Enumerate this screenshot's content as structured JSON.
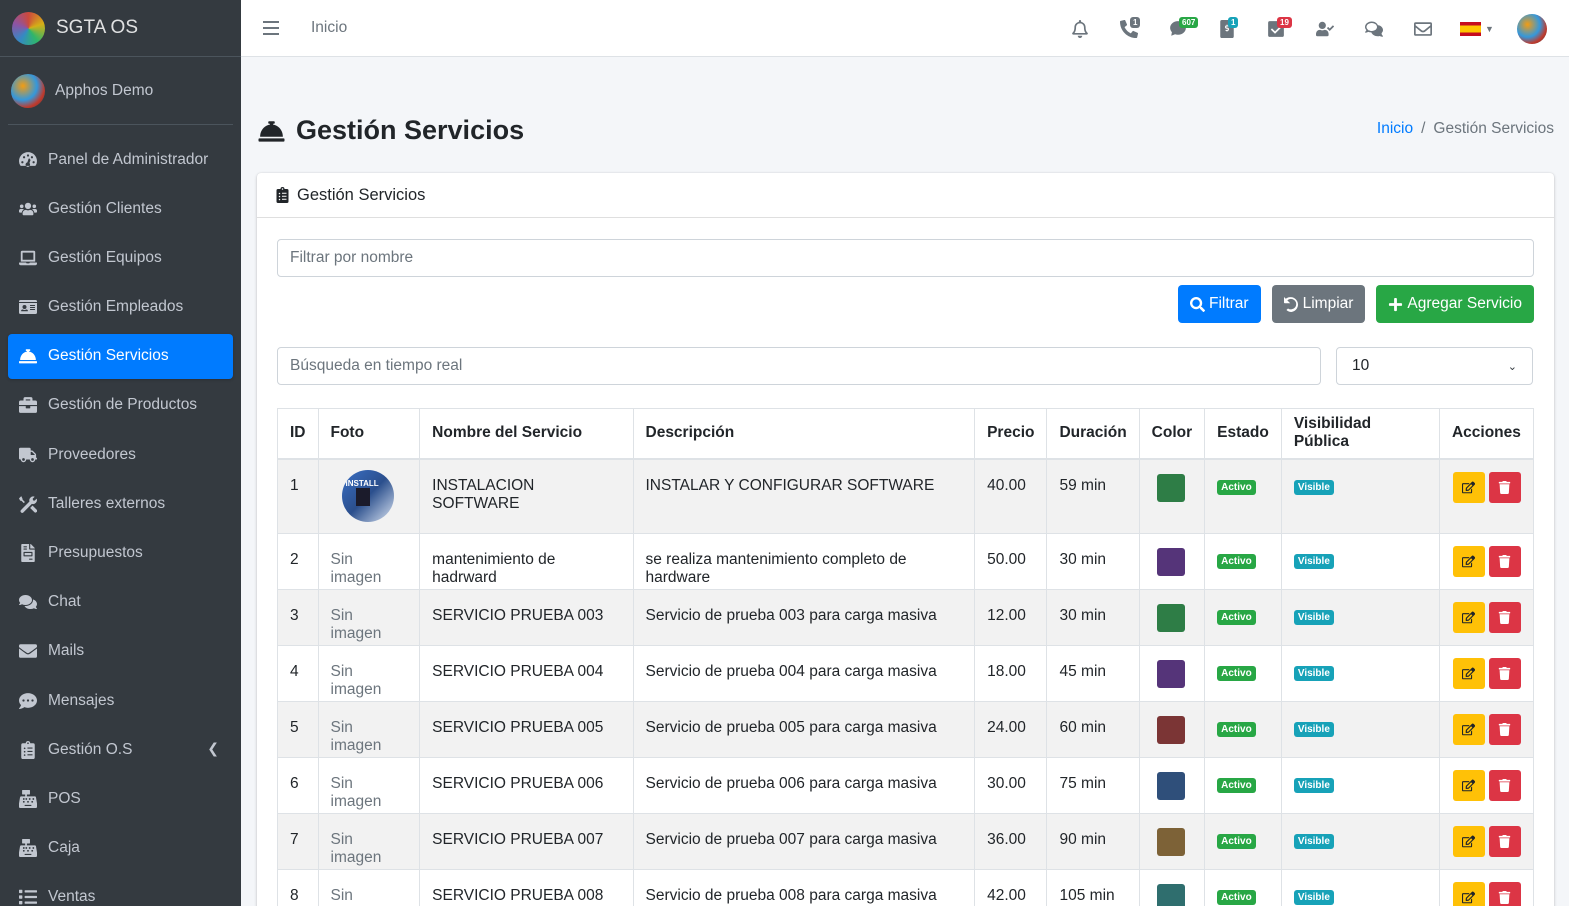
{
  "brand": {
    "name": "SGTA OS"
  },
  "user": {
    "name": "Apphos Demo"
  },
  "sidebar": {
    "items": [
      {
        "label": "Panel de Administrador",
        "icon": "dashboard-icon"
      },
      {
        "label": "Gestión Clientes",
        "icon": "users-icon"
      },
      {
        "label": "Gestión Equipos",
        "icon": "laptop-icon"
      },
      {
        "label": "Gestión Empleados",
        "icon": "id-card-icon"
      },
      {
        "label": "Gestión Servicios",
        "icon": "concierge-bell-icon",
        "active": true
      },
      {
        "label": "Gestión de Productos",
        "icon": "briefcase-icon"
      },
      {
        "label": "Proveedores",
        "icon": "truck-icon"
      },
      {
        "label": "Talleres externos",
        "icon": "tools-icon"
      },
      {
        "label": "Presupuestos",
        "icon": "file-invoice-icon"
      },
      {
        "label": "Chat",
        "icon": "comments-icon"
      },
      {
        "label": "Mails",
        "icon": "envelope-icon"
      },
      {
        "label": "Mensajes",
        "icon": "comment-dots-icon"
      },
      {
        "label": "Gestión O.S",
        "icon": "clipboard-icon",
        "has_submenu": true
      },
      {
        "label": "POS",
        "icon": "cash-register-icon"
      },
      {
        "label": "Caja",
        "icon": "cash-register-icon"
      },
      {
        "label": "Ventas",
        "icon": "list-icon"
      }
    ]
  },
  "topbar": {
    "home_link": "Inicio",
    "badges": {
      "phone": "1",
      "chat": "607",
      "money": "1",
      "tasks": "19"
    }
  },
  "colors": {
    "primary": "#007bff",
    "secondary": "#6c757d",
    "success": "#28a745",
    "warning": "#ffc107",
    "danger": "#dc3545",
    "info": "#17a2b8",
    "sidebar_bg": "#343a40"
  },
  "header": {
    "title": "Gestión Servicios",
    "breadcrumb": {
      "home": "Inicio",
      "current": "Gestión Servicios"
    }
  },
  "card": {
    "title": "Gestión Servicios",
    "filter_placeholder": "Filtrar por nombre",
    "buttons": {
      "filter": "Filtrar",
      "clear": "Limpiar",
      "add": "Agregar Servicio"
    },
    "search_placeholder": "Búsqueda en tiempo real",
    "page_size": "10"
  },
  "table": {
    "headers": [
      "ID",
      "Foto",
      "Nombre del Servicio",
      "Descripción",
      "Precio",
      "Duración",
      "Color",
      "Estado",
      "Visibilidad Pública",
      "Acciones"
    ],
    "thumb_text": "INSTALL",
    "rows": [
      {
        "id": "1",
        "foto": "",
        "nombre": "INSTALACION SOFTWARE",
        "descripcion": "INSTALAR Y CONFIGURAR SOFTWARE",
        "precio": "40.00",
        "duracion": "59 min",
        "color": "#2e7d46",
        "estado": "Activo",
        "visibilidad": "Visible"
      },
      {
        "id": "2",
        "foto": "Sin imagen",
        "nombre": "mantenimiento de hadrward",
        "descripcion": "se realiza mantenimiento completo de hardware",
        "precio": "50.00",
        "duracion": "30 min",
        "color": "#553479",
        "estado": "Activo",
        "visibilidad": "Visible"
      },
      {
        "id": "3",
        "foto": "Sin imagen",
        "nombre": "SERVICIO PRUEBA 003",
        "descripcion": "Servicio de prueba 003 para carga masiva",
        "precio": "12.00",
        "duracion": "30 min",
        "color": "#2e7d46",
        "estado": "Activo",
        "visibilidad": "Visible"
      },
      {
        "id": "4",
        "foto": "Sin imagen",
        "nombre": "SERVICIO PRUEBA 004",
        "descripcion": "Servicio de prueba 004 para carga masiva",
        "precio": "18.00",
        "duracion": "45 min",
        "color": "#553479",
        "estado": "Activo",
        "visibilidad": "Visible"
      },
      {
        "id": "5",
        "foto": "Sin imagen",
        "nombre": "SERVICIO PRUEBA 005",
        "descripcion": "Servicio de prueba 005 para carga masiva",
        "precio": "24.00",
        "duracion": "60 min",
        "color": "#7b3535",
        "estado": "Activo",
        "visibilidad": "Visible"
      },
      {
        "id": "6",
        "foto": "Sin imagen",
        "nombre": "SERVICIO PRUEBA 006",
        "descripcion": "Servicio de prueba 006 para carga masiva",
        "precio": "30.00",
        "duracion": "75 min",
        "color": "#2f4f7a",
        "estado": "Activo",
        "visibilidad": "Visible"
      },
      {
        "id": "7",
        "foto": "Sin imagen",
        "nombre": "SERVICIO PRUEBA 007",
        "descripcion": "Servicio de prueba 007 para carga masiva",
        "precio": "36.00",
        "duracion": "90 min",
        "color": "#7d6237",
        "estado": "Activo",
        "visibilidad": "Visible"
      },
      {
        "id": "8",
        "foto": "Sin imagen",
        "nombre": "SERVICIO PRUEBA 008",
        "descripcion": "Servicio de prueba 008 para carga masiva",
        "precio": "42.00",
        "duracion": "105 min",
        "color": "#2f6e6e",
        "estado": "Activo",
        "visibilidad": "Visible"
      }
    ]
  }
}
